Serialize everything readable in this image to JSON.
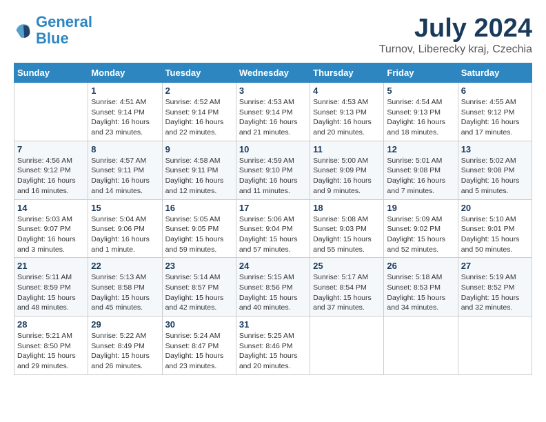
{
  "logo": {
    "line1": "General",
    "line2": "Blue"
  },
  "title": {
    "month_year": "July 2024",
    "location": "Turnov, Liberecky kraj, Czechia"
  },
  "header": {
    "days": [
      "Sunday",
      "Monday",
      "Tuesday",
      "Wednesday",
      "Thursday",
      "Friday",
      "Saturday"
    ]
  },
  "weeks": [
    {
      "cells": [
        {
          "day": "",
          "sunrise": "",
          "sunset": "",
          "daylight": ""
        },
        {
          "day": "1",
          "sunrise": "Sunrise: 4:51 AM",
          "sunset": "Sunset: 9:14 PM",
          "daylight": "Daylight: 16 hours and 23 minutes."
        },
        {
          "day": "2",
          "sunrise": "Sunrise: 4:52 AM",
          "sunset": "Sunset: 9:14 PM",
          "daylight": "Daylight: 16 hours and 22 minutes."
        },
        {
          "day": "3",
          "sunrise": "Sunrise: 4:53 AM",
          "sunset": "Sunset: 9:14 PM",
          "daylight": "Daylight: 16 hours and 21 minutes."
        },
        {
          "day": "4",
          "sunrise": "Sunrise: 4:53 AM",
          "sunset": "Sunset: 9:13 PM",
          "daylight": "Daylight: 16 hours and 20 minutes."
        },
        {
          "day": "5",
          "sunrise": "Sunrise: 4:54 AM",
          "sunset": "Sunset: 9:13 PM",
          "daylight": "Daylight: 16 hours and 18 minutes."
        },
        {
          "day": "6",
          "sunrise": "Sunrise: 4:55 AM",
          "sunset": "Sunset: 9:12 PM",
          "daylight": "Daylight: 16 hours and 17 minutes."
        }
      ]
    },
    {
      "cells": [
        {
          "day": "7",
          "sunrise": "Sunrise: 4:56 AM",
          "sunset": "Sunset: 9:12 PM",
          "daylight": "Daylight: 16 hours and 16 minutes."
        },
        {
          "day": "8",
          "sunrise": "Sunrise: 4:57 AM",
          "sunset": "Sunset: 9:11 PM",
          "daylight": "Daylight: 16 hours and 14 minutes."
        },
        {
          "day": "9",
          "sunrise": "Sunrise: 4:58 AM",
          "sunset": "Sunset: 9:11 PM",
          "daylight": "Daylight: 16 hours and 12 minutes."
        },
        {
          "day": "10",
          "sunrise": "Sunrise: 4:59 AM",
          "sunset": "Sunset: 9:10 PM",
          "daylight": "Daylight: 16 hours and 11 minutes."
        },
        {
          "day": "11",
          "sunrise": "Sunrise: 5:00 AM",
          "sunset": "Sunset: 9:09 PM",
          "daylight": "Daylight: 16 hours and 9 minutes."
        },
        {
          "day": "12",
          "sunrise": "Sunrise: 5:01 AM",
          "sunset": "Sunset: 9:08 PM",
          "daylight": "Daylight: 16 hours and 7 minutes."
        },
        {
          "day": "13",
          "sunrise": "Sunrise: 5:02 AM",
          "sunset": "Sunset: 9:08 PM",
          "daylight": "Daylight: 16 hours and 5 minutes."
        }
      ]
    },
    {
      "cells": [
        {
          "day": "14",
          "sunrise": "Sunrise: 5:03 AM",
          "sunset": "Sunset: 9:07 PM",
          "daylight": "Daylight: 16 hours and 3 minutes."
        },
        {
          "day": "15",
          "sunrise": "Sunrise: 5:04 AM",
          "sunset": "Sunset: 9:06 PM",
          "daylight": "Daylight: 16 hours and 1 minute."
        },
        {
          "day": "16",
          "sunrise": "Sunrise: 5:05 AM",
          "sunset": "Sunset: 9:05 PM",
          "daylight": "Daylight: 15 hours and 59 minutes."
        },
        {
          "day": "17",
          "sunrise": "Sunrise: 5:06 AM",
          "sunset": "Sunset: 9:04 PM",
          "daylight": "Daylight: 15 hours and 57 minutes."
        },
        {
          "day": "18",
          "sunrise": "Sunrise: 5:08 AM",
          "sunset": "Sunset: 9:03 PM",
          "daylight": "Daylight: 15 hours and 55 minutes."
        },
        {
          "day": "19",
          "sunrise": "Sunrise: 5:09 AM",
          "sunset": "Sunset: 9:02 PM",
          "daylight": "Daylight: 15 hours and 52 minutes."
        },
        {
          "day": "20",
          "sunrise": "Sunrise: 5:10 AM",
          "sunset": "Sunset: 9:01 PM",
          "daylight": "Daylight: 15 hours and 50 minutes."
        }
      ]
    },
    {
      "cells": [
        {
          "day": "21",
          "sunrise": "Sunrise: 5:11 AM",
          "sunset": "Sunset: 8:59 PM",
          "daylight": "Daylight: 15 hours and 48 minutes."
        },
        {
          "day": "22",
          "sunrise": "Sunrise: 5:13 AM",
          "sunset": "Sunset: 8:58 PM",
          "daylight": "Daylight: 15 hours and 45 minutes."
        },
        {
          "day": "23",
          "sunrise": "Sunrise: 5:14 AM",
          "sunset": "Sunset: 8:57 PM",
          "daylight": "Daylight: 15 hours and 42 minutes."
        },
        {
          "day": "24",
          "sunrise": "Sunrise: 5:15 AM",
          "sunset": "Sunset: 8:56 PM",
          "daylight": "Daylight: 15 hours and 40 minutes."
        },
        {
          "day": "25",
          "sunrise": "Sunrise: 5:17 AM",
          "sunset": "Sunset: 8:54 PM",
          "daylight": "Daylight: 15 hours and 37 minutes."
        },
        {
          "day": "26",
          "sunrise": "Sunrise: 5:18 AM",
          "sunset": "Sunset: 8:53 PM",
          "daylight": "Daylight: 15 hours and 34 minutes."
        },
        {
          "day": "27",
          "sunrise": "Sunrise: 5:19 AM",
          "sunset": "Sunset: 8:52 PM",
          "daylight": "Daylight: 15 hours and 32 minutes."
        }
      ]
    },
    {
      "cells": [
        {
          "day": "28",
          "sunrise": "Sunrise: 5:21 AM",
          "sunset": "Sunset: 8:50 PM",
          "daylight": "Daylight: 15 hours and 29 minutes."
        },
        {
          "day": "29",
          "sunrise": "Sunrise: 5:22 AM",
          "sunset": "Sunset: 8:49 PM",
          "daylight": "Daylight: 15 hours and 26 minutes."
        },
        {
          "day": "30",
          "sunrise": "Sunrise: 5:24 AM",
          "sunset": "Sunset: 8:47 PM",
          "daylight": "Daylight: 15 hours and 23 minutes."
        },
        {
          "day": "31",
          "sunrise": "Sunrise: 5:25 AM",
          "sunset": "Sunset: 8:46 PM",
          "daylight": "Daylight: 15 hours and 20 minutes."
        },
        {
          "day": "",
          "sunrise": "",
          "sunset": "",
          "daylight": ""
        },
        {
          "day": "",
          "sunrise": "",
          "sunset": "",
          "daylight": ""
        },
        {
          "day": "",
          "sunrise": "",
          "sunset": "",
          "daylight": ""
        }
      ]
    }
  ]
}
